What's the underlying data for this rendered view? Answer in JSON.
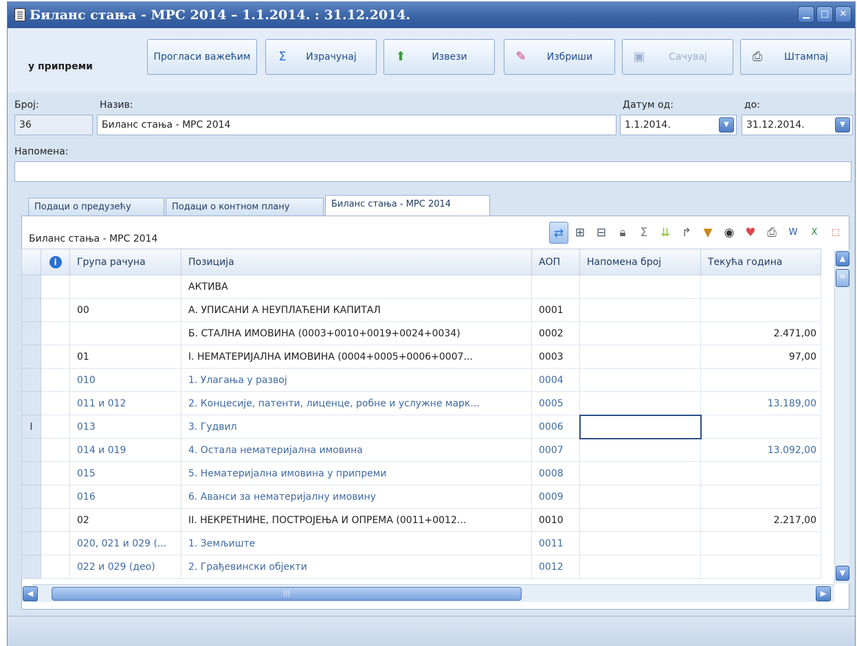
{
  "window": {
    "title": "Биланс стања - МРС 2014 – 1.1.2014. : 31.12.2014.",
    "controls": [
      "minimize",
      "maximize",
      "close"
    ]
  },
  "toolbar": {
    "state": "у припреми",
    "buttons": [
      {
        "label": "Прогласи важећим",
        "icon": "",
        "enabled": true
      },
      {
        "label": "Израчунај",
        "icon": "sigma-icon",
        "enabled": true
      },
      {
        "label": "Извези",
        "icon": "export-icon",
        "enabled": true
      },
      {
        "label": "Избриши",
        "icon": "eraser-icon",
        "enabled": true
      },
      {
        "label": "Сачувај",
        "icon": "save-icon",
        "enabled": false
      },
      {
        "label": "Штампај",
        "icon": "printer-icon",
        "enabled": true
      }
    ]
  },
  "form": {
    "number_label": "Број:",
    "number_value": "36",
    "name_label": "Назив:",
    "name_value": "Биланс стања - МРС 2014",
    "date_from_label": "Датум од:",
    "date_from_value": "1.1.2014.",
    "date_to_label": "до:",
    "date_to_value": "31.12.2014.",
    "note_label": "Напомена:",
    "note_value": ""
  },
  "tabs": [
    {
      "label": "Подаци о предузећу",
      "active": false
    },
    {
      "label": "Подаци о контном плану",
      "active": false
    },
    {
      "label": "Биланс стања - МРС 2014",
      "active": true
    }
  ],
  "grid": {
    "title": "Биланс стања - МРС 2014",
    "tool_icons": [
      "refresh-icon",
      "add-row-icon",
      "remove-row-icon",
      "lock-icon",
      "sum-icon",
      "expand-icon",
      "redirect-icon",
      "filter-icon",
      "eye-icon",
      "hearts-icon",
      "print-icon",
      "word-export-icon",
      "excel-export-icon",
      "pdf-export-icon"
    ],
    "columns": [
      "Група рачуна",
      "Позиција",
      "АОП",
      "Напомена број",
      "Текућа година"
    ],
    "rows": [
      {
        "group": "",
        "position": "АКТИВА",
        "aop": "",
        "note": "",
        "current": "",
        "style": "black"
      },
      {
        "group": "00",
        "position": "А. УПИСАНИ А НЕУПЛАЋЕНИ КАПИТАЛ",
        "aop": "0001",
        "note": "",
        "current": "",
        "style": "black"
      },
      {
        "group": "",
        "position": "Б. СТАЛНА ИМОВИНА  (0003+0010+0019+0024+0034)",
        "aop": "0002",
        "note": "",
        "current": "2.471,00",
        "style": "black"
      },
      {
        "group": "01",
        "position": "I. НЕМАТЕРИЈАЛНА ИМОВИНА (0004+0005+0006+0007...",
        "aop": "0003",
        "note": "",
        "current": "97,00",
        "style": "black"
      },
      {
        "group": "010",
        "position": "1. Улагања у развој",
        "aop": "0004",
        "note": "",
        "current": "",
        "style": "blue"
      },
      {
        "group": "011 и 012",
        "position": "2. Концесије, патенти, лиценце, робне и услужне марк...",
        "aop": "0005",
        "note": "",
        "current": "13.189,00",
        "style": "blue"
      },
      {
        "group": "013",
        "position": "3. Гудвил",
        "aop": "0006",
        "note": "",
        "current": "",
        "style": "blue",
        "editing": true
      },
      {
        "group": "014 и 019",
        "position": "4. Остала нематеријална имовина",
        "aop": "0007",
        "note": "",
        "current": "13.092,00",
        "style": "blue"
      },
      {
        "group": "015",
        "position": "5. Нематеријална имовина у припреми",
        "aop": "0008",
        "note": "",
        "current": "",
        "style": "blue"
      },
      {
        "group": "016",
        "position": "6. Аванси за нематеријалну имовину",
        "aop": "0009",
        "note": "",
        "current": "",
        "style": "blue"
      },
      {
        "group": "02",
        "position": "II. НЕКРЕТНИНЕ, ПОСТРОЈЕЊА И ОПРЕМА (0011+0012...",
        "aop": "0010",
        "note": "",
        "current": "2.217,00",
        "style": "black"
      },
      {
        "group": "020, 021 и 029 (...",
        "position": "1. Земљиште",
        "aop": "0011",
        "note": "",
        "current": "",
        "style": "blue"
      },
      {
        "group": "022 и 029 (део)",
        "position": "2. Грађевински објекти",
        "aop": "0012",
        "note": "",
        "current": "",
        "style": "blue"
      }
    ]
  },
  "colors": {
    "title_bar": "#3a64a6",
    "button_text": "#1f4b8a",
    "blue_row_text": "#3f6aa3"
  }
}
